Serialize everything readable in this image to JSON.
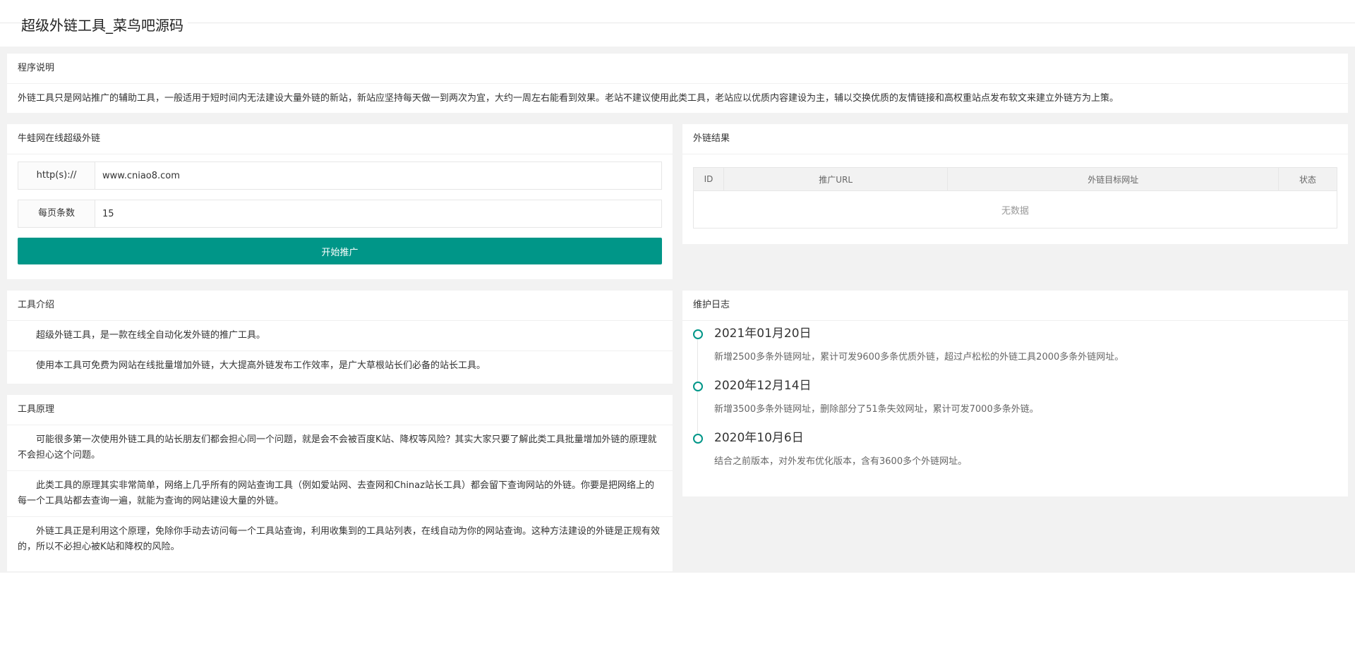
{
  "page": {
    "title": "超级外链工具_菜鸟吧源码"
  },
  "intro": {
    "heading": "程序说明",
    "text": "外链工具只是网站推广的辅助工具，一般适用于短时间内无法建设大量外链的新站，新站应坚持每天做一到两次为宜，大约一周左右能看到效果。老站不建议使用此类工具，老站应以优质内容建设为主，辅以交换优质的友情链接和高权重站点发布软文来建立外链方为上策。"
  },
  "form": {
    "heading": "牛蛙网在线超级外链",
    "url_label": "http(s)://",
    "url_value": "www.cniao8.com",
    "count_label": "每页条数",
    "count_value": "15",
    "submit_label": "开始推广"
  },
  "result": {
    "heading": "外链结果",
    "columns": [
      "ID",
      "推广URL",
      "外链目标网址",
      "状态"
    ],
    "empty_text": "无数据"
  },
  "tool_intro": {
    "heading": "工具介绍",
    "paragraphs": [
      "超级外链工具，是一款在线全自动化发外链的推广工具。",
      "使用本工具可免费为网站在线批量增加外链，大大提高外链发布工作效率，是广大草根站长们必备的站长工具。"
    ]
  },
  "principle": {
    "heading": "工具原理",
    "paragraphs": [
      "可能很多第一次使用外链工具的站长朋友们都会担心同一个问题，就是会不会被百度K站、降权等风险？其实大家只要了解此类工具批量增加外链的原理就不会担心这个问题。",
      "此类工具的原理其实非常简单，网络上几乎所有的网站查询工具（例如爱站网、去查网和Chinaz站长工具）都会留下查询网站的外链。你要是把网络上的每一个工具站都去查询一遍，就能为查询的网站建设大量的外链。",
      "外链工具正是利用这个原理，免除你手动去访问每一个工具站查询，利用收集到的工具站列表，在线自动为你的网站查询。这种方法建设的外链是正规有效的，所以不必担心被K站和降权的风险。"
    ]
  },
  "log": {
    "heading": "维护日志",
    "items": [
      {
        "date": "2021年01月20日",
        "text": "新增2500多条外链网址，累计可发9600多条优质外链，超过卢松松的外链工具2000多条外链网址。"
      },
      {
        "date": "2020年12月14日",
        "text": "新增3500多条外链网址，删除部分了51条失效网址，累计可发7000多条外链。"
      },
      {
        "date": "2020年10月6日",
        "text": "结合之前版本，对外发布优化版本，含有3600多个外链网址。"
      }
    ]
  },
  "colors": {
    "accent": "#009688",
    "background": "#f2f2f2"
  }
}
